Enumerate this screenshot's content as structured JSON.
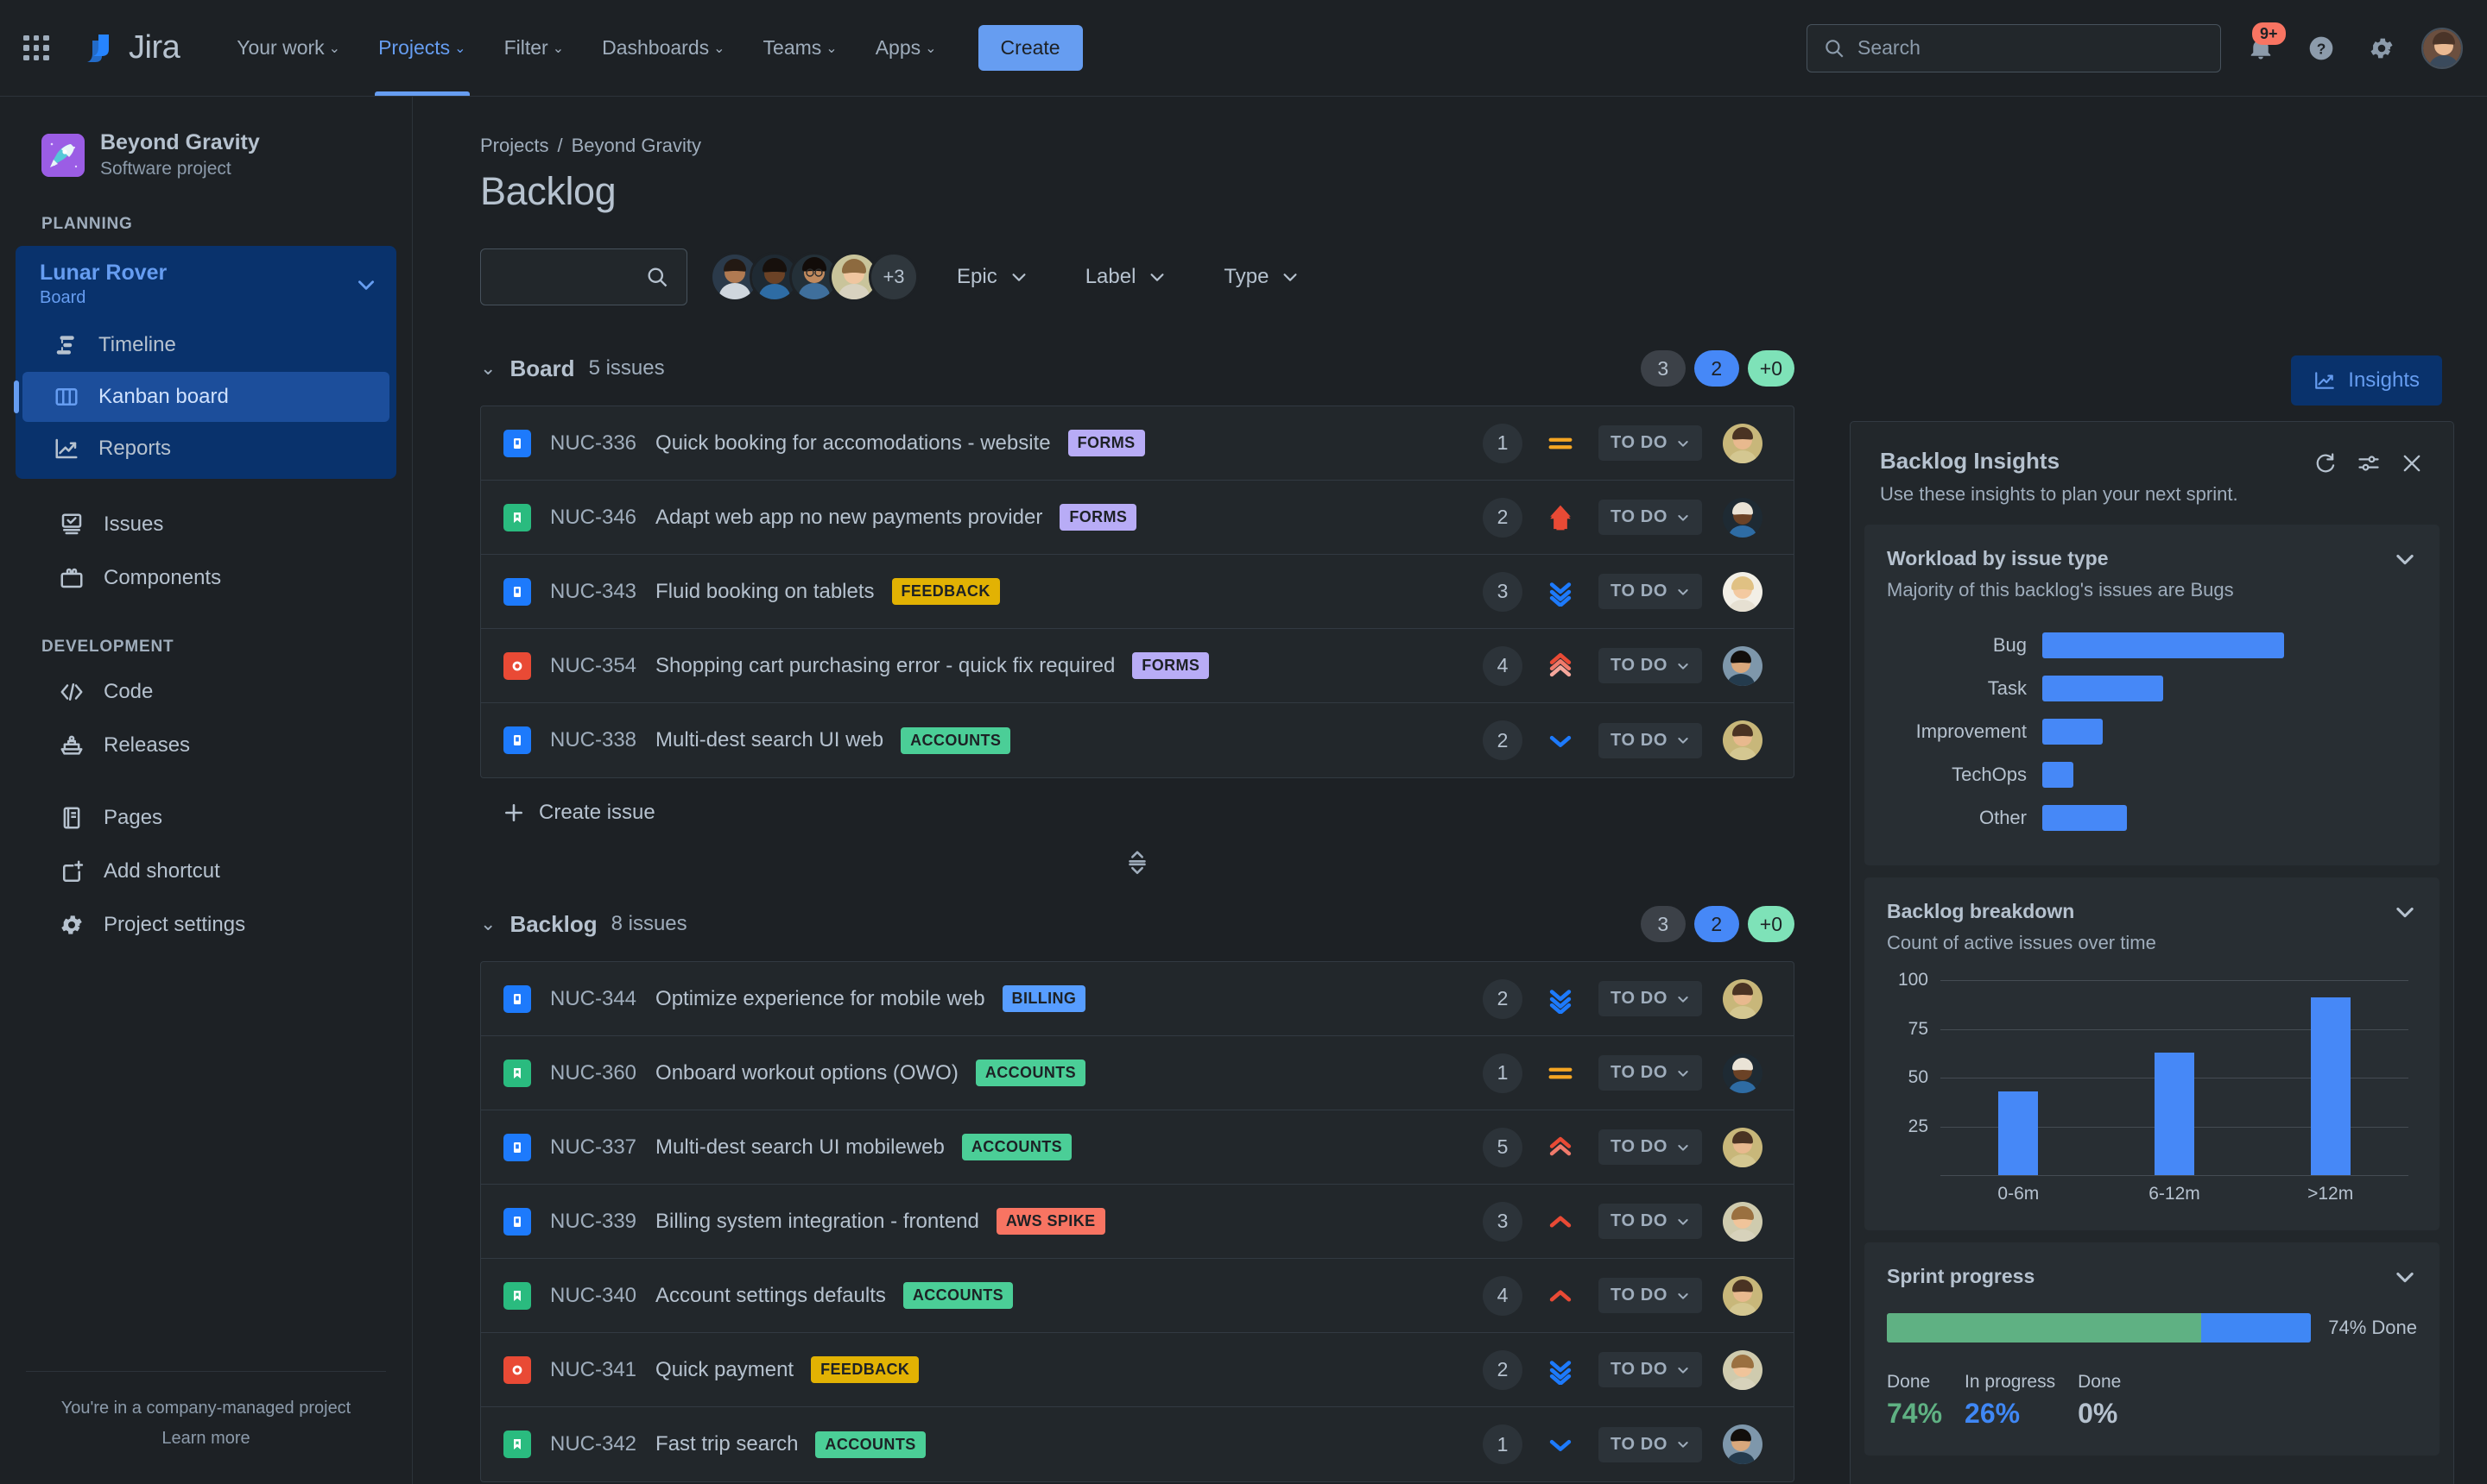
{
  "topnav": {
    "apps_icon": "apps-grid-icon",
    "brand": "Jira",
    "items": [
      {
        "label": "Your work",
        "active": false
      },
      {
        "label": "Projects",
        "active": true
      },
      {
        "label": "Filter",
        "active": false
      },
      {
        "label": "Dashboards",
        "active": false
      },
      {
        "label": "Teams",
        "active": false
      },
      {
        "label": "Apps",
        "active": false
      }
    ],
    "create_label": "Create",
    "search_placeholder": "Search",
    "notification_badge": "9+",
    "help_icon": "question-circle-icon",
    "settings_icon": "gear-icon",
    "profile_icon": "user-avatar"
  },
  "sidebar": {
    "project_name": "Beyond Gravity",
    "project_type": "Software project",
    "planning_label": "PLANNING",
    "board": {
      "name": "Lunar Rover",
      "sub": "Board"
    },
    "board_items": [
      {
        "label": "Timeline",
        "icon": "timeline-icon",
        "selected": false
      },
      {
        "label": "Kanban board",
        "icon": "board-columns-icon",
        "selected": true
      },
      {
        "label": "Reports",
        "icon": "reports-chart-icon",
        "selected": false
      }
    ],
    "planning_items": [
      {
        "label": "Issues",
        "icon": "issues-icon"
      },
      {
        "label": "Components",
        "icon": "components-icon"
      }
    ],
    "development_label": "DEVELOPMENT",
    "development_items": [
      {
        "label": "Code",
        "icon": "code-icon"
      },
      {
        "label": "Releases",
        "icon": "releases-ship-icon"
      }
    ],
    "other_items": [
      {
        "label": "Pages",
        "icon": "pages-document-icon"
      },
      {
        "label": "Add shortcut",
        "icon": "add-shortcut-icon"
      },
      {
        "label": "Project settings",
        "icon": "gear-icon"
      }
    ],
    "footer_text": "You're in a company-managed project",
    "footer_link": "Learn more"
  },
  "main": {
    "breadcrumb": [
      "Projects",
      "/",
      "Beyond Gravity"
    ],
    "page_title": "Backlog",
    "search_value": "",
    "avatar_overflow": "+3",
    "filters": [
      {
        "label": "Epic"
      },
      {
        "label": "Label"
      },
      {
        "label": "Type"
      }
    ],
    "insights_button": "Insights",
    "create_issue_label": "Create issue",
    "sections": [
      {
        "name": "Board",
        "count": "5 issues",
        "pills": [
          {
            "text": "3",
            "color": "grey"
          },
          {
            "text": "2",
            "color": "blue"
          },
          {
            "text": "+0",
            "color": "green"
          }
        ],
        "issues": [
          {
            "key": "NUC-336",
            "summary": "Quick booking for accomodations - website",
            "epic": "FORMS",
            "epic_color": "#b8acf6",
            "type": "story",
            "type_color": "#1d7afc",
            "estimate": "1",
            "priority": "medium",
            "status": "TO DO",
            "avatar": "a1"
          },
          {
            "key": "NUC-346",
            "summary": "Adapt web app no new payments provider",
            "epic": "FORMS",
            "epic_color": "#b8acf6",
            "type": "task",
            "type_color": "#2abb7f",
            "estimate": "2",
            "priority": "highest",
            "status": "TO DO",
            "avatar": "a2"
          },
          {
            "key": "NUC-343",
            "summary": "Fluid booking on tablets",
            "epic": "FEEDBACK",
            "epic_color": "#e2b203",
            "type": "story",
            "type_color": "#1d7afc",
            "estimate": "3",
            "priority": "lowest",
            "status": "TO DO",
            "avatar": "a3"
          },
          {
            "key": "NUC-354",
            "summary": "Shopping cart purchasing error - quick fix required",
            "epic": "FORMS",
            "epic_color": "#b8acf6",
            "type": "bug",
            "type_color": "#e94a35",
            "estimate": "4",
            "priority": "high2",
            "status": "TO DO",
            "avatar": "a4"
          },
          {
            "key": "NUC-338",
            "summary": "Multi-dest search UI web",
            "epic": "ACCOUNTS",
            "epic_color": "#4bce97",
            "type": "story",
            "type_color": "#1d7afc",
            "estimate": "2",
            "priority": "low",
            "status": "TO DO",
            "avatar": "a1"
          }
        ]
      },
      {
        "name": "Backlog",
        "count": "8 issues",
        "pills": [
          {
            "text": "3",
            "color": "grey"
          },
          {
            "text": "2",
            "color": "blue"
          },
          {
            "text": "+0",
            "color": "green"
          }
        ],
        "issues": [
          {
            "key": "NUC-344",
            "summary": "Optimize experience for mobile web",
            "epic": "BILLING",
            "epic_color": "#579dff",
            "type": "story",
            "type_color": "#1d7afc",
            "estimate": "2",
            "priority": "lowest",
            "status": "TO DO",
            "avatar": "a1"
          },
          {
            "key": "NUC-360",
            "summary": "Onboard workout options (OWO)",
            "epic": "ACCOUNTS",
            "epic_color": "#4bce97",
            "type": "task",
            "type_color": "#2abb7f",
            "estimate": "1",
            "priority": "medium",
            "status": "TO DO",
            "avatar": "a2"
          },
          {
            "key": "NUC-337",
            "summary": "Multi-dest search UI mobileweb",
            "epic": "ACCOUNTS",
            "epic_color": "#4bce97",
            "type": "story",
            "type_color": "#1d7afc",
            "estimate": "5",
            "priority": "high2",
            "status": "TO DO",
            "avatar": "a1"
          },
          {
            "key": "NUC-339",
            "summary": "Billing system integration - frontend",
            "epic": "AWS SPIKE",
            "epic_color": "#f87462",
            "type": "story",
            "type_color": "#1d7afc",
            "estimate": "3",
            "priority": "high",
            "status": "TO DO",
            "avatar": "a5"
          },
          {
            "key": "NUC-340",
            "summary": "Account settings defaults",
            "epic": "ACCOUNTS",
            "epic_color": "#4bce97",
            "type": "task",
            "type_color": "#2abb7f",
            "estimate": "4",
            "priority": "high",
            "status": "TO DO",
            "avatar": "a1"
          },
          {
            "key": "NUC-341",
            "summary": "Quick payment",
            "epic": "FEEDBACK",
            "epic_color": "#e2b203",
            "type": "bug",
            "type_color": "#e94a35",
            "estimate": "2",
            "priority": "lowest",
            "status": "TO DO",
            "avatar": "a5"
          },
          {
            "key": "NUC-342",
            "summary": "Fast trip search",
            "epic": "ACCOUNTS",
            "epic_color": "#4bce97",
            "type": "task",
            "type_color": "#2abb7f",
            "estimate": "1",
            "priority": "low",
            "status": "TO DO",
            "avatar": "a4"
          }
        ]
      }
    ]
  },
  "insights": {
    "title": "Backlog Insights",
    "subtitle": "Use these insights to plan your next sprint.",
    "refresh_icon": "refresh-icon",
    "filter_icon": "sliders-icon",
    "close_icon": "close-icon",
    "workload": {
      "title": "Workload by issue type",
      "subtitle": "Majority of this backlog's issues are Bugs"
    },
    "breakdown": {
      "title": "Backlog breakdown",
      "subtitle": "Count of active issues over time"
    },
    "sprint": {
      "title": "Sprint progress",
      "bar_label": "74% Done",
      "stats": [
        {
          "key": "Done",
          "value": "74%",
          "color": "#5fb183"
        },
        {
          "key": "In progress",
          "value": "26%",
          "color": "#3f87f5"
        },
        {
          "key": "Done",
          "value": "0%",
          "color": "#b6c2cf"
        }
      ]
    }
  },
  "chart_data": [
    {
      "type": "bar",
      "orientation": "horizontal",
      "title": "Workload by issue type",
      "subtitle": "Majority of this backlog's issues are Bugs",
      "categories": [
        "Bug",
        "Task",
        "Improvement",
        "TechOps",
        "Other"
      ],
      "values": [
        100,
        50,
        25,
        13,
        35
      ],
      "unit": "relative width %",
      "xlabel": "",
      "ylabel": "",
      "grid": false,
      "legend": "none",
      "color": "#4688f7"
    },
    {
      "type": "bar",
      "orientation": "vertical",
      "title": "Backlog breakdown",
      "subtitle": "Count of active issues over time",
      "categories": [
        "0-6m",
        "6-12m",
        ">12m"
      ],
      "values": [
        43,
        63,
        91
      ],
      "xlabel": "",
      "ylabel": "",
      "ylim": [
        0,
        100
      ],
      "yticks": [
        25,
        50,
        75,
        100
      ],
      "grid": true,
      "legend": "none",
      "color": "#4688f7"
    },
    {
      "type": "bar",
      "orientation": "stacked-horizontal",
      "title": "Sprint progress",
      "categories": [
        "Done",
        "In progress",
        "Done"
      ],
      "values": [
        74,
        26,
        0
      ],
      "unit": "%",
      "annotation": "74% Done",
      "colors": [
        "#5fb183",
        "#3f87f5",
        "#b6c2cf"
      ],
      "legend": "bottom"
    }
  ]
}
